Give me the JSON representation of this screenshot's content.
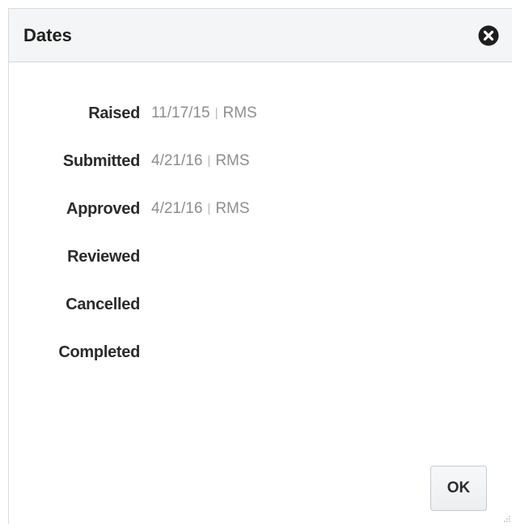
{
  "dialog": {
    "title": "Dates",
    "close_icon": "circle-x-icon",
    "rows": [
      {
        "label": "Raised",
        "date": "11/17/15",
        "separator": "|",
        "source": "RMS"
      },
      {
        "label": "Submitted",
        "date": "4/21/16",
        "separator": "|",
        "source": "RMS"
      },
      {
        "label": "Approved",
        "date": "4/21/16",
        "separator": "|",
        "source": "RMS"
      },
      {
        "label": "Reviewed",
        "date": "",
        "separator": "",
        "source": ""
      },
      {
        "label": "Cancelled",
        "date": "",
        "separator": "",
        "source": ""
      },
      {
        "label": "Completed",
        "date": "",
        "separator": "",
        "source": ""
      }
    ],
    "ok_label": "OK"
  },
  "colors": {
    "header_bg": "#f4f5f6",
    "label_text": "#2b2b2b",
    "value_text": "#8e8e8e",
    "close_icon_fill": "#1f1f1f"
  }
}
